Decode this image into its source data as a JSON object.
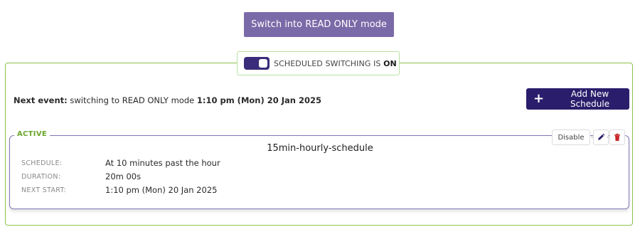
{
  "mode_button": {
    "label": "Switch into READ ONLY mode"
  },
  "scheduled_switching": {
    "label_prefix": "SCHEDULED SWITCHING IS ",
    "state": "ON"
  },
  "next_event": {
    "prefix": "Next event:",
    "text": " switching to READ ONLY mode ",
    "time": "1:10 pm  (Mon)  20 Jan 2025"
  },
  "add_schedule_button": {
    "label": "Add New Schedule"
  },
  "schedules": [
    {
      "status": "ACTIVE",
      "name": "15min-hourly-schedule",
      "disable_label": "Disable",
      "fields": [
        {
          "label": "SCHEDULE:",
          "value": "At 10 minutes past the hour"
        },
        {
          "label": "DURATION:",
          "value": "20m 00s"
        },
        {
          "label": "NEXT START:",
          "value": "1:10 pm  (Mon)  20 Jan 2025"
        }
      ]
    }
  ],
  "colors": {
    "primary": "#2a1d6b",
    "mode_button": "#7b6aa8",
    "panel_border": "#8bc34a",
    "active_text": "#6aa62a",
    "delete": "#c62828"
  },
  "icons": {
    "add": "plus-icon",
    "edit": "pencil-icon",
    "delete": "trash-icon"
  }
}
